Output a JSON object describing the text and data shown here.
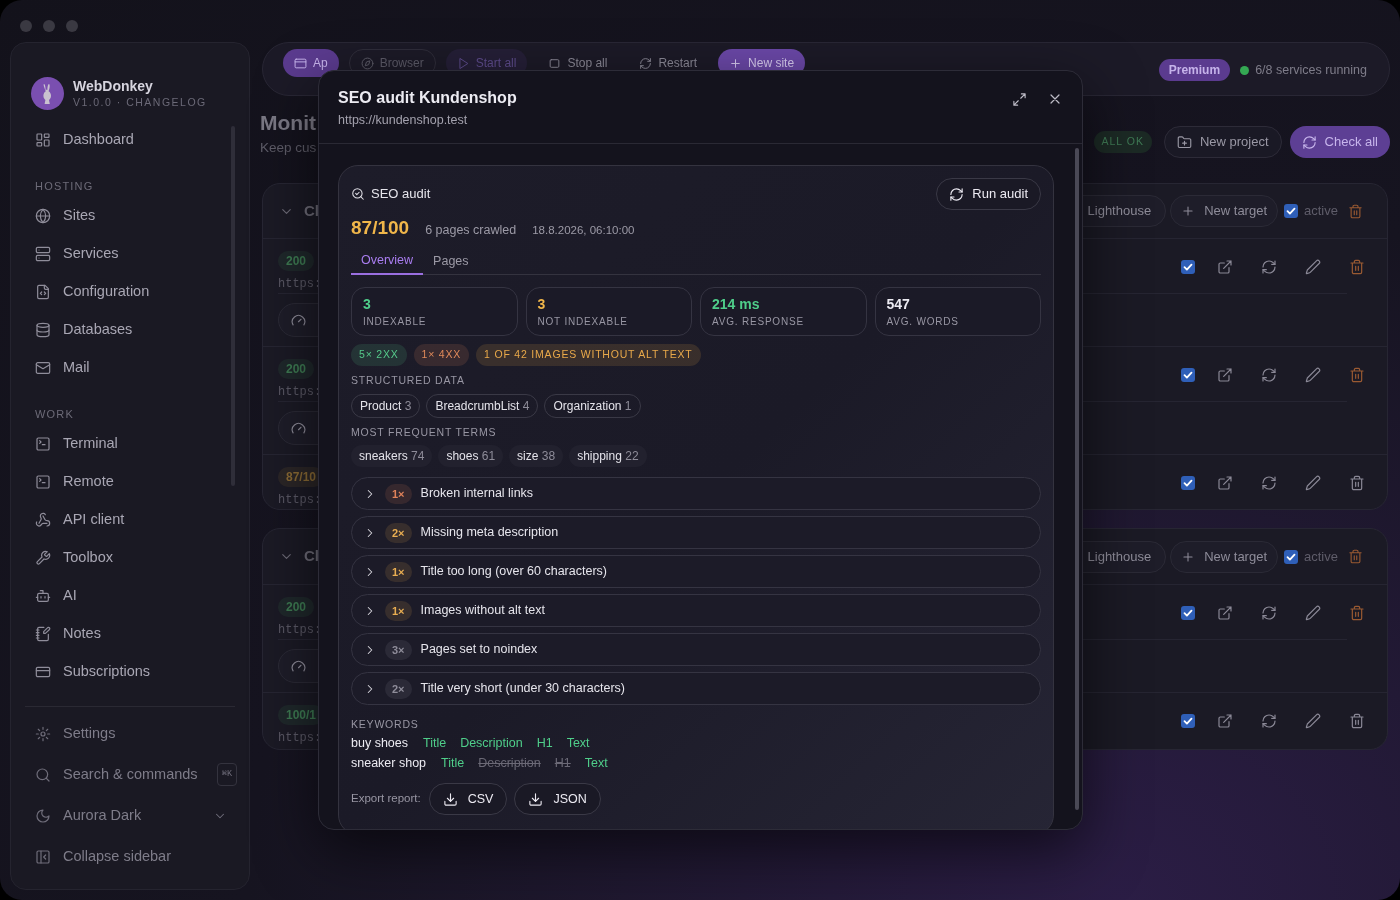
{
  "sidebar": {
    "brand": "WebDonkey",
    "subtitle": "V1.0.0 · CHANGELOG",
    "groups": [
      {
        "items": [
          {
            "label": "Dashboard"
          }
        ]
      },
      {
        "heading": "HOSTING",
        "items": [
          {
            "label": "Sites"
          },
          {
            "label": "Services"
          },
          {
            "label": "Configuration"
          },
          {
            "label": "Databases"
          },
          {
            "label": "Mail"
          }
        ]
      },
      {
        "heading": "WORK",
        "items": [
          {
            "label": "Terminal"
          },
          {
            "label": "Remote"
          },
          {
            "label": "API client"
          },
          {
            "label": "Toolbox"
          },
          {
            "label": "AI"
          },
          {
            "label": "Notes"
          },
          {
            "label": "Subscriptions"
          }
        ]
      }
    ],
    "footer": [
      {
        "label": "Settings"
      },
      {
        "label": "Search & commands",
        "shortcut": "⌘K"
      },
      {
        "label": "Aurora Dark",
        "dropdown": true
      },
      {
        "label": "Collapse sidebar"
      }
    ]
  },
  "toolbar": {
    "buttons": [
      {
        "label": "Ap",
        "kind": "selected"
      },
      {
        "label": "Browser",
        "kind": "ghost"
      },
      {
        "label": "Start all",
        "kind": "dim"
      },
      {
        "label": "Stop all",
        "kind": "plain"
      },
      {
        "label": "Restart",
        "kind": "plain"
      },
      {
        "label": "New site",
        "kind": "accent"
      }
    ],
    "plan": "Premium",
    "status": "6/8 services running"
  },
  "page": {
    "title": "Monit",
    "subtitle": "Keep cus",
    "status_badge": "ALL OK",
    "actions": [
      {
        "label": "New project",
        "kind": "plain"
      },
      {
        "label": "Check all",
        "kind": "accent"
      }
    ]
  },
  "cards": [
    {
      "title": "Cl",
      "buttons": [
        "Lighthouse",
        "New target"
      ],
      "active_label": "active",
      "active": true,
      "rows": [
        {
          "badge": "200",
          "color": "#3d7a52",
          "url": "https:",
          "metrics_button": true,
          "active": true,
          "deletable": true
        },
        {
          "badge": "200",
          "color": "#3d7a52",
          "url": "https:",
          "metrics_button": true,
          "active": true,
          "deletable": true
        },
        {
          "badge": "87/10",
          "color": "#8a6a34",
          "url": "https:",
          "metrics_button": false,
          "active": true,
          "deletable": false
        }
      ]
    },
    {
      "title": "Cl",
      "buttons": [
        "Lighthouse",
        "New target"
      ],
      "active_label": "active",
      "active": true,
      "rows": [
        {
          "badge": "200",
          "color": "#3d7a52",
          "url": "https:",
          "metrics_button": true,
          "active": true,
          "deletable": true
        },
        {
          "badge": "100/1",
          "color": "#3d7a52",
          "url": "https:",
          "metrics_button": false,
          "active": true,
          "deletable": false
        }
      ]
    }
  ],
  "modal": {
    "title": "SEO audit Kundenshop",
    "url": "https://kundenshop.test",
    "audit": {
      "heading": "SEO audit",
      "run_button": "Run audit",
      "score": "87/100",
      "pages": "6 pages crawled",
      "date": "18.8.2026, 06:10:00",
      "tabs": [
        {
          "label": "Overview",
          "selected": true
        },
        {
          "label": "Pages",
          "selected": false
        }
      ],
      "stats": [
        {
          "value": "3",
          "label": "INDEXABLE",
          "color": "#4fce8a"
        },
        {
          "value": "3",
          "label": "NOT INDEXABLE",
          "color": "#f0b64a"
        },
        {
          "value": "214 ms",
          "label": "AVG. RESPONSE",
          "color": "#4fce8a"
        },
        {
          "value": "547",
          "label": "AVG. WORDS",
          "color": "#ecebf2"
        }
      ],
      "badges": [
        {
          "text": "5× 2XX",
          "color": "#55c98a"
        },
        {
          "text": "1× 4XX",
          "color": "#e08a5a"
        },
        {
          "text": "1 OF 42 IMAGES WITHOUT ALT TEXT",
          "color": "#e9a94a"
        }
      ],
      "structured_data": {
        "heading": "STRUCTURED DATA",
        "items": [
          {
            "name": "Product",
            "count": "3"
          },
          {
            "name": "BreadcrumbList",
            "count": "4"
          },
          {
            "name": "Organization",
            "count": "1"
          }
        ]
      },
      "terms": {
        "heading": "MOST FREQUENT TERMS",
        "items": [
          {
            "term": "sneakers",
            "count": "74"
          },
          {
            "term": "shoes",
            "count": "61"
          },
          {
            "term": "size",
            "count": "38"
          },
          {
            "term": "shipping",
            "count": "22"
          }
        ]
      },
      "issues": [
        {
          "count": "1×",
          "title": "Broken internal links",
          "color": "#e0825a",
          "expanded": false
        },
        {
          "count": "2×",
          "title": "Missing meta description",
          "color": "#e9ae52",
          "expanded": false
        },
        {
          "count": "1×",
          "title": "Title too long (over 60 characters)",
          "color": "#e9ae52",
          "expanded": false
        },
        {
          "count": "1×",
          "title": "Images without alt text",
          "color": "#e9ae52",
          "expanded": false
        },
        {
          "count": "3×",
          "title": "Pages set to noindex",
          "color": "#8f8d9a",
          "expanded": false
        },
        {
          "count": "2×",
          "title": "Title very short (under 30 characters)",
          "color": "#8f8d9a",
          "expanded": false
        }
      ],
      "keywords": {
        "heading": "KEYWORDS",
        "rows": [
          {
            "keyword": "buy shoes",
            "checks": [
              {
                "label": "Title",
                "found": true
              },
              {
                "label": "Description",
                "found": true
              },
              {
                "label": "H1",
                "found": true
              },
              {
                "label": "Text",
                "found": true
              }
            ]
          },
          {
            "keyword": "sneaker shop",
            "checks": [
              {
                "label": "Title",
                "found": true
              },
              {
                "label": "Description",
                "found": false
              },
              {
                "label": "H1",
                "found": false
              },
              {
                "label": "Text",
                "found": true
              }
            ]
          }
        ]
      },
      "export": {
        "label": "Export report:",
        "buttons": [
          "CSV",
          "JSON"
        ]
      }
    }
  }
}
